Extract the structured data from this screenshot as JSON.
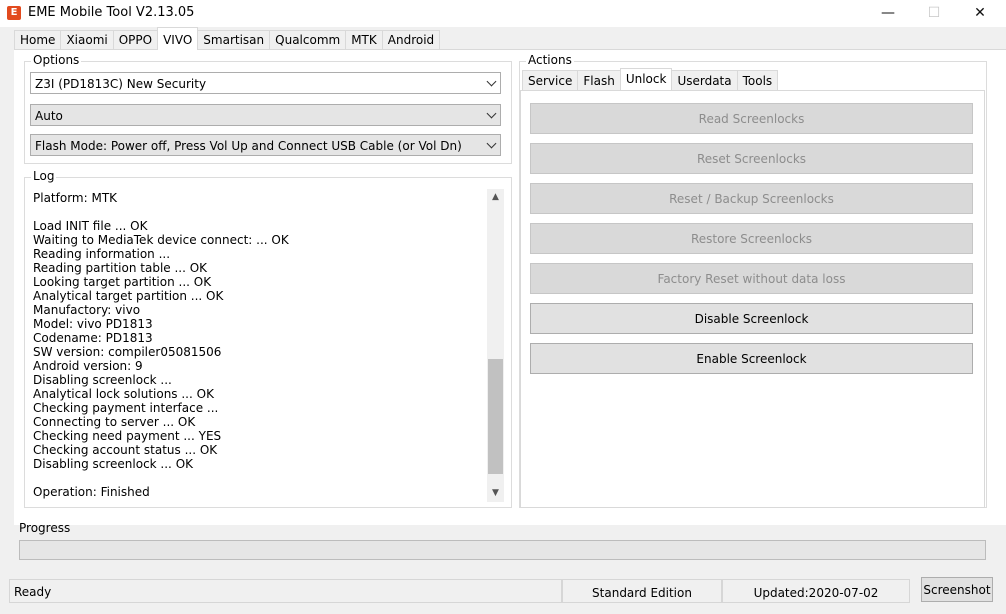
{
  "window": {
    "title": "EME Mobile Tool V2.13.05",
    "minimize": "—",
    "maximize": "☐",
    "close": "✕"
  },
  "main_tabs": [
    "Home",
    "Xiaomi",
    "OPPO",
    "VIVO",
    "Smartisan",
    "Qualcomm",
    "MTK",
    "Android"
  ],
  "options": {
    "title": "Options",
    "model_select": "Z3I (PD1813C) New Security",
    "mode_select": "Auto",
    "flash_mode_select": "Flash Mode: Power off, Press Vol Up and Connect USB Cable (or Vol Dn)"
  },
  "log": {
    "title": "Log",
    "lines": [
      "Platform: MTK",
      "",
      "Load INIT file ... OK",
      "Waiting to MediaTek device connect: ... OK",
      "Reading information ...",
      "Reading partition table ... OK",
      "Looking target partition ... OK",
      "Analytical target partition ... OK",
      "Manufactory: vivo",
      "Model: vivo PD1813",
      "Codename: PD1813",
      "SW version: compiler05081506",
      "Android version: 9",
      "Disabling screenlock ...",
      "Analytical lock solutions ... OK",
      "Checking payment interface ...",
      "Connecting to server ... OK",
      "Checking need payment ... YES",
      "Checking account status ... OK",
      "Disabling screenlock ... OK",
      "",
      "Operation: Finished"
    ]
  },
  "actions": {
    "title": "Actions",
    "tabs": [
      "Service",
      "Flash",
      "Unlock",
      "Userdata",
      "Tools"
    ],
    "buttons": {
      "read": "Read Screenlocks",
      "reset": "Reset Screenlocks",
      "reset_backup": "Reset / Backup Screenlocks",
      "restore": "Restore Screenlocks",
      "factory_reset": "Factory Reset without data loss",
      "disable": "Disable Screenlock",
      "enable": "Enable Screenlock"
    }
  },
  "progress": {
    "label": "Progress",
    "value": 0
  },
  "status": {
    "text": "Ready",
    "edition": "Standard Edition",
    "updated": "Updated:2020-07-02",
    "screenshot": "Screenshot"
  }
}
